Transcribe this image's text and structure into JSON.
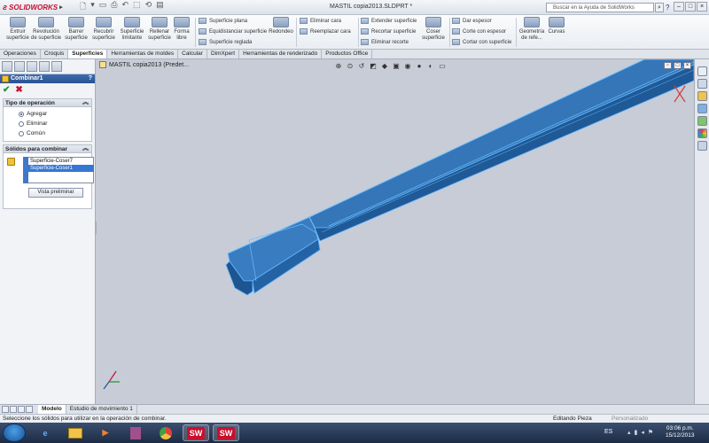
{
  "window": {
    "app_name": "SOLIDWORKS",
    "doc_title": "MASTIL copia2013.SLDPRT *",
    "search_placeholder": "Buscar en la Ayuda de SolidWorks",
    "help_label": "?"
  },
  "ribbon": {
    "big_buttons": [
      {
        "label": "Extruir superficie"
      },
      {
        "label": "Revolución de superficie"
      },
      {
        "label": "Barrer superficie"
      },
      {
        "label": "Recubrir superficie"
      },
      {
        "label": "Superficie limitante"
      },
      {
        "label": "Rellenar superficie"
      },
      {
        "label": "Forma libre"
      }
    ],
    "group1": [
      "Superficie plana",
      "Equidistanciar superficie",
      "Superficie reglada"
    ],
    "redondeo": "Redondeo",
    "group2": [
      "Eliminar cara",
      "Reemplazar cara"
    ],
    "group3": [
      "Extender superficie",
      "Recortar superficie",
      "Eliminar recorte"
    ],
    "coser": "Coser superficie",
    "group4": [
      "Dar espesor",
      "Corte con espesor",
      "Cortar con superficie"
    ],
    "geometria": "Geometría de refe...",
    "curvas": "Curvas"
  },
  "tabs": [
    "Operaciones",
    "Croquis",
    "Superficies",
    "Herramientas de moldes",
    "Calcular",
    "DimXpert",
    "Herramientas de renderizado",
    "Productos Office"
  ],
  "active_tab": "Superficies",
  "property_manager": {
    "title": "Combinar1",
    "help": "?",
    "ok_icon": "✔",
    "cancel_icon": "✖",
    "op_group_title": "Tipo de operación",
    "operations": [
      {
        "label": "Agregar",
        "selected": true
      },
      {
        "label": "Eliminar",
        "selected": false
      },
      {
        "label": "Común",
        "selected": false
      }
    ],
    "bodies_group_title": "Sólidos para combinar",
    "bodies": [
      {
        "label": "Superficie-Coser7",
        "selected": false
      },
      {
        "label": "Superficie-Coser1",
        "selected": true
      }
    ],
    "preview_button": "Vista preliminar"
  },
  "viewport": {
    "tree_label": "MASTIL copia2013  (Predet...",
    "model_color": "#2e6fb0",
    "edge_color": "#5fb4ff"
  },
  "bottom_tabs": [
    "Modelo",
    "Estudio de movimiento 1"
  ],
  "active_bottom_tab": "Modelo",
  "status": {
    "message": "Seleccione los sólidos para utilizar en la operación de combinar.",
    "mode": "Editando Pieza",
    "personalized": "Personalizado"
  },
  "taskbar": {
    "language": "ES",
    "time": "03:06 p.m.",
    "date": "15/12/2013",
    "sw_label": "SW"
  }
}
